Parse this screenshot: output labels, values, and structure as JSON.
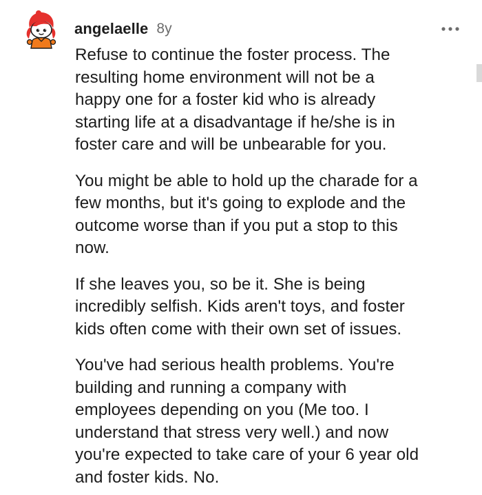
{
  "comment": {
    "username": "angelaelle",
    "age": "8y",
    "avatar_icon": "reddit-snoo-avatar-icon",
    "more_icon": "more-options-icon",
    "paragraphs": [
      {
        "lines": [
          "Refuse to continue the foster process. The",
          "resulting home environment will not be a",
          "happy one for a foster kid who is already",
          "starting life at a disadvantage if he/she is in",
          "foster care and will be unbearable for you."
        ]
      },
      {
        "lines": [
          "You might be able to hold up the charade for a",
          "few months, but it's going to explode and the",
          "outcome worse than if you put a stop to this",
          "now."
        ]
      },
      {
        "lines": [
          "If she leaves you, so be it. She is being",
          "incredibly selfish. Kids aren't toys, and foster",
          "kids often come with their own set of issues."
        ]
      },
      {
        "lines": [
          "You've had serious health problems. You're",
          "building and running a company with",
          "employees depending on you (Me too. I",
          "understand that stress very well.) and now",
          "you're expected to take care of your 6 year old",
          "and foster kids. No."
        ]
      }
    ]
  },
  "colors": {
    "text": "#1c1c1c",
    "meta": "#6c6c6c",
    "avatar_hair": "#e5312d",
    "avatar_outfit": "#f07a1c"
  }
}
